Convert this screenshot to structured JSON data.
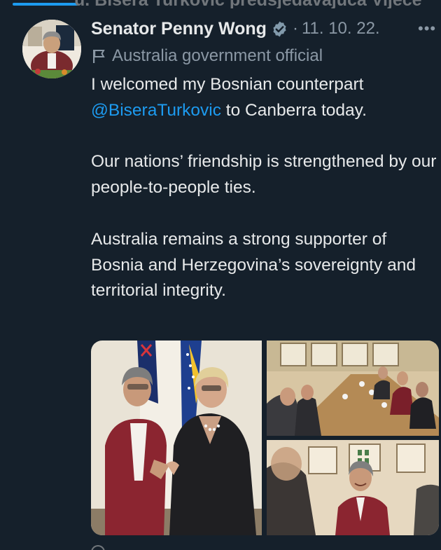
{
  "top": {
    "cut_text": "u. Bisera Turković predsjedavajuća Vijeće"
  },
  "author": {
    "display_name": "Senator Penny Wong",
    "verified": true,
    "timestamp": "11. 10. 22.",
    "affiliation": "Australia government official"
  },
  "tweet": {
    "line1": "I welcomed my Bosnian counterpart",
    "mention": "@BiseraTurkovic",
    "line2_rest": " to Canberra today.",
    "para2": "Our nations’ friendship is strengthened by our people-to-people ties.",
    "para3": "Australia remains a strong supporter of Bosnia and Herzegovina’s sovereignty and territorial integrity."
  },
  "colors": {
    "background": "#15202b",
    "text": "#e7e9ea",
    "muted": "#8b98a5",
    "accent": "#1d9bf0"
  },
  "icons": {
    "verified": "verified-badge-icon",
    "affiliation": "flag-icon",
    "more": "more-options-icon"
  }
}
